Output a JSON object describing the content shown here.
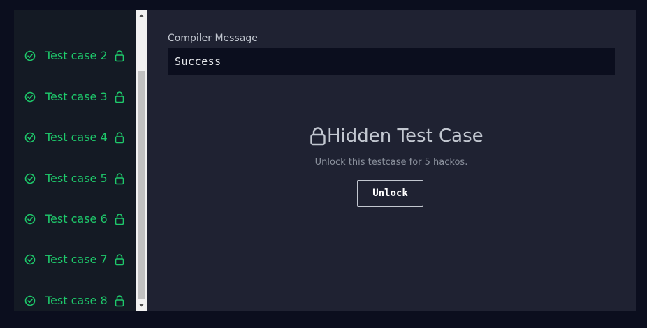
{
  "sidebar": {
    "items": [
      {
        "label": "Test case 2"
      },
      {
        "label": "Test case 3"
      },
      {
        "label": "Test case 4"
      },
      {
        "label": "Test case 5"
      },
      {
        "label": "Test case 6"
      },
      {
        "label": "Test case 7"
      },
      {
        "label": "Test case 8"
      }
    ]
  },
  "main": {
    "compiler_label": "Compiler Message",
    "compiler_message": "Success",
    "hidden_title": "Hidden Test Case",
    "unlock_description": "Unlock this testcase for 5 hackos.",
    "unlock_button": "Unlock"
  },
  "colors": {
    "page_bg": "#0b0e1e",
    "sidebar_bg": "#141a24",
    "panel_bg": "#1f2232",
    "success_green": "#1ec96b",
    "text_light": "#c2c7d0"
  },
  "icons": {
    "status": "check-circle-icon",
    "locked": "lock-icon"
  }
}
